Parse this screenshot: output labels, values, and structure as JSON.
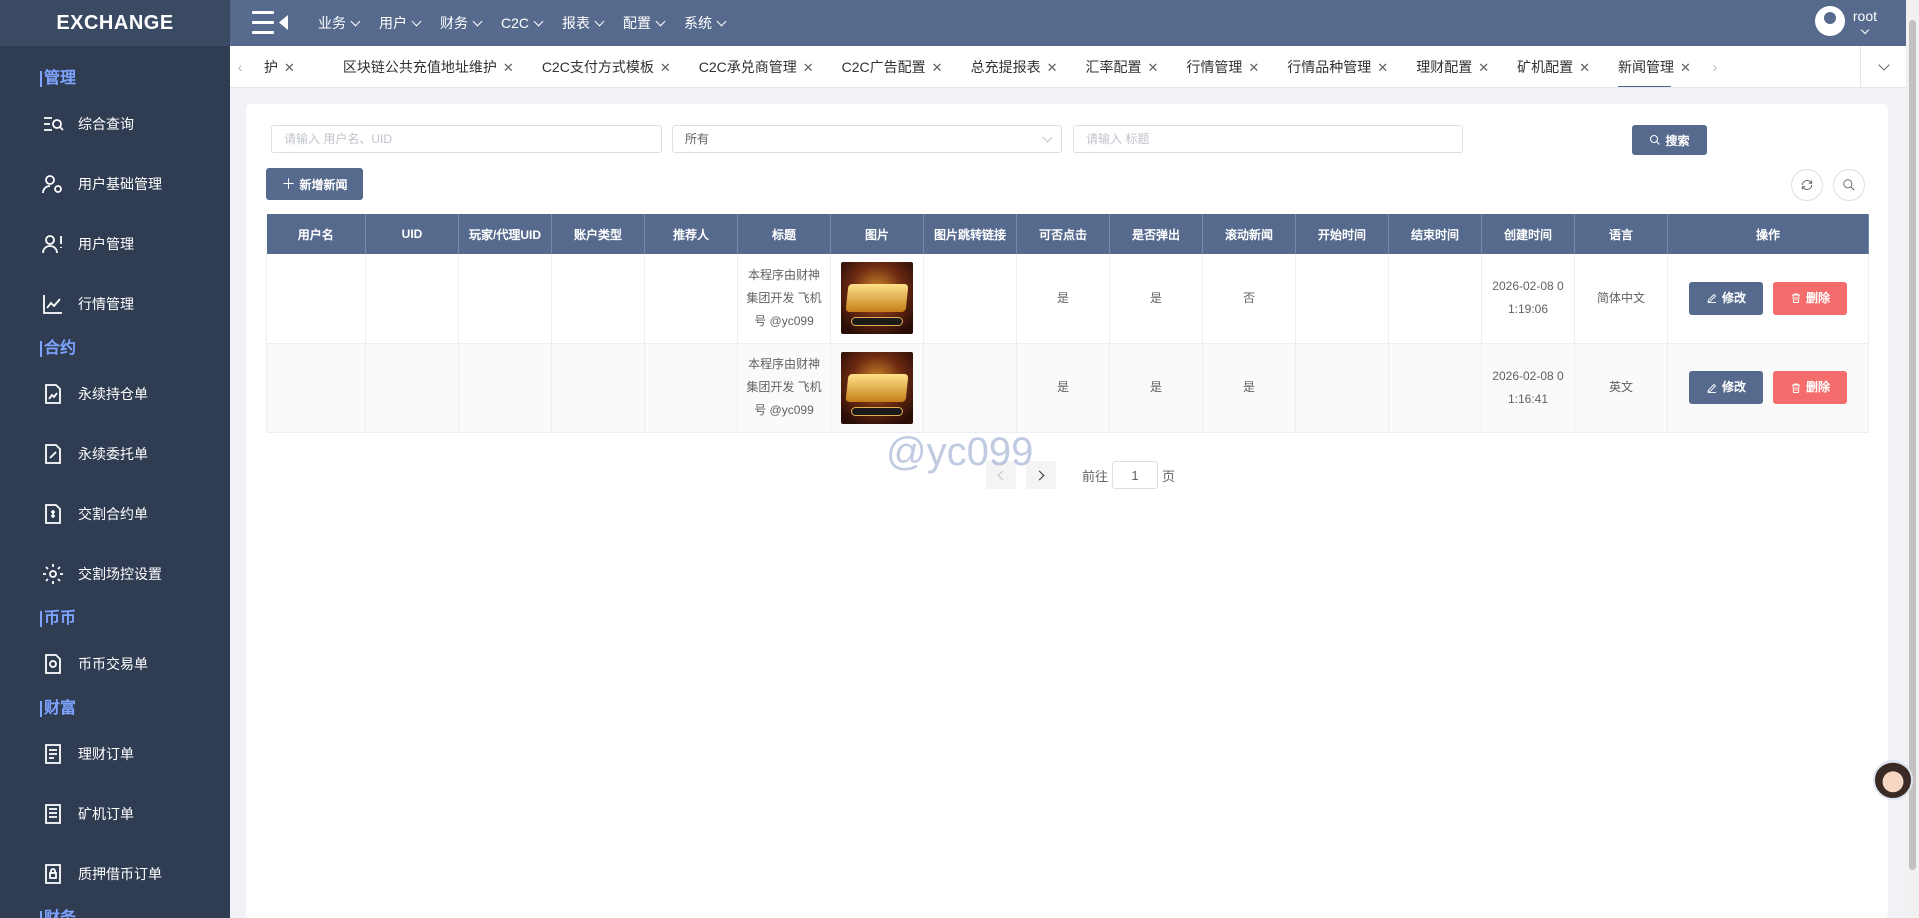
{
  "app": {
    "logo": "EXCHANGE"
  },
  "header": {
    "menus": [
      "业务",
      "用户",
      "财务",
      "C2C",
      "报表",
      "配置",
      "系统"
    ],
    "user": "root"
  },
  "sidebar": {
    "groups": [
      {
        "title": "管理",
        "items": [
          "综合查询",
          "用户基础管理",
          "用户管理",
          "行情管理"
        ]
      },
      {
        "title": "合约",
        "items": [
          "永续持仓单",
          "永续委托单",
          "交割合约单",
          "交割场控设置"
        ]
      },
      {
        "title": "币币",
        "items": [
          "币币交易单"
        ]
      },
      {
        "title": "财富",
        "items": [
          "理财订单",
          "矿机订单",
          "质押借币订单"
        ]
      },
      {
        "title": "财务",
        "items": []
      }
    ]
  },
  "tabs": [
    "护",
    "区块链公共充值地址维护",
    "C2C支付方式模板",
    "C2C承兑商管理",
    "C2C广告配置",
    "总充提报表",
    "汇率配置",
    "行情管理",
    "行情品种管理",
    "理财配置",
    "矿机配置",
    "新闻管理"
  ],
  "search": {
    "user_placeholder": "请输入 用户名、UID",
    "select_value": "所有",
    "title_placeholder": "请输入 标题",
    "button": "搜索"
  },
  "toolbar": {
    "add_button": "新增新闻"
  },
  "table": {
    "headers": [
      "用户名",
      "UID",
      "玩家/代理UID",
      "账户类型",
      "推荐人",
      "标题",
      "图片",
      "图片跳转链接",
      "可否点击",
      "是否弹出",
      "滚动新闻",
      "开始时间",
      "结束时间",
      "创建时间",
      "语言",
      "操作"
    ],
    "rows": [
      {
        "title": "本程序由财神集团开发 飞机号 @yc099",
        "clickable": "是",
        "popup": "是",
        "scroll": "否",
        "created": "2026-02-08 01:19:06",
        "lang": "简体中文"
      },
      {
        "title": "本程序由财神集团开发 飞机号 @yc099",
        "clickable": "是",
        "popup": "是",
        "scroll": "是",
        "created": "2026-02-08 01:16:41",
        "lang": "英文"
      }
    ],
    "edit_label": "修改",
    "delete_label": "删除"
  },
  "pager": {
    "goto_label": "前往",
    "page": "1",
    "page_suffix": "页"
  },
  "watermark": "@yc099",
  "colors": {
    "primary": "#566a8e",
    "sidebar": "#2f3c52",
    "danger": "#f56c6c",
    "group_title": "#7ea4ff"
  }
}
